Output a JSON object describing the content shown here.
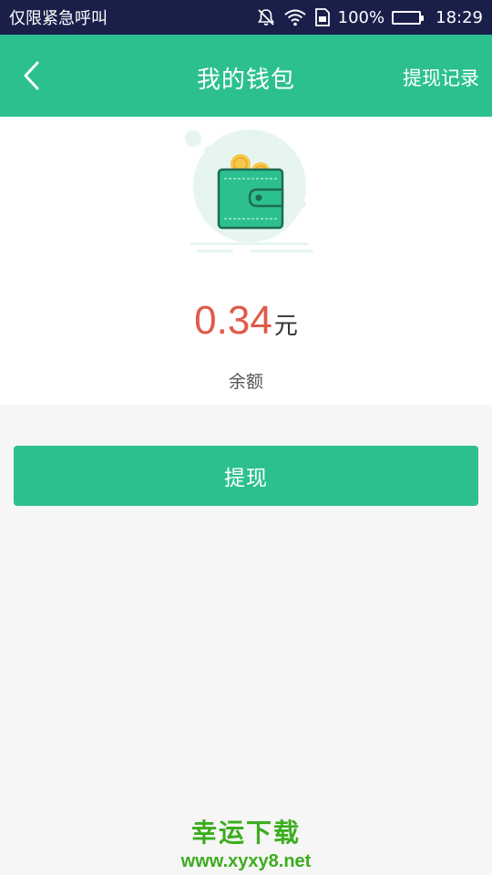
{
  "status_bar": {
    "carrier_text": "仅限紧急呼叫",
    "battery_percent": "100%",
    "time": "18:29",
    "icons": [
      "mute-icon",
      "wifi-icon",
      "sim-icon",
      "battery-icon"
    ]
  },
  "header": {
    "back_icon": "chevron-left-icon",
    "title": "我的钱包",
    "action_label": "提现记录"
  },
  "wallet": {
    "illustration": "wallet-icon",
    "balance": "0.34",
    "unit": "元",
    "label": "余额"
  },
  "actions": {
    "withdraw_label": "提现"
  },
  "watermark": {
    "name": "幸运下载",
    "url": "www.xyxy8.net"
  },
  "colors": {
    "accent": "#2cc090",
    "status_bar": "#1a1f4a",
    "balance": "#e05a49",
    "background": "#f6f6f6",
    "watermark": "#3cad1f"
  }
}
